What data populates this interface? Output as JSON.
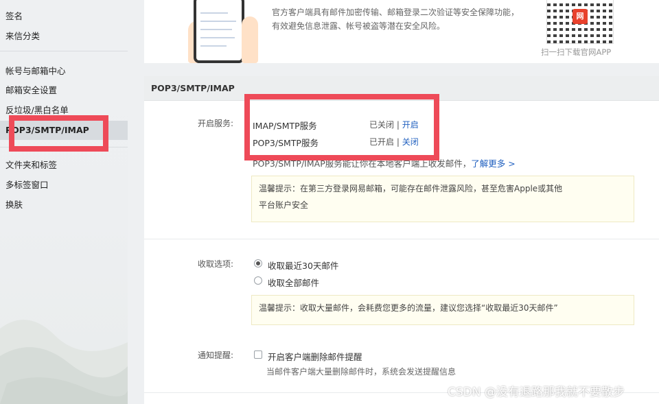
{
  "sidebar": {
    "items": [
      {
        "label": "签名"
      },
      {
        "label": "来信分类"
      },
      {
        "label": "帐号与邮箱中心"
      },
      {
        "label": "邮箱安全设置"
      },
      {
        "label": "反垃圾/黑白名单"
      },
      {
        "label": "POP3/SMTP/IMAP",
        "active": true
      },
      {
        "label": "文件夹和标签"
      },
      {
        "label": "多标签窗口"
      },
      {
        "label": "换肤"
      }
    ]
  },
  "banner": {
    "text": "官方客户端具有邮件加密传输、邮箱登录二次验证等安全保障功能，有效避免信息泄露、帐号被盗等潜在安全风险。",
    "qr_caption": "扫一扫下载官网APP",
    "qr_logo": "网"
  },
  "section": {
    "title": "POP3/SMTP/IMAP",
    "service_label": "开启服务:",
    "services": [
      {
        "name": "IMAP/SMTP服务",
        "status": "已关闭",
        "sep": " | ",
        "action": "开启"
      },
      {
        "name": "POP3/SMTP服务",
        "status": "已开启",
        "sep": " | ",
        "action": "关闭"
      }
    ],
    "desc": "POP3/SMTP/IMAP服务能让你在本地客户端上收发邮件，",
    "learn_more": "了解更多 >",
    "tip1_line1": "温馨提示：在第三方登录网易邮箱，可能存在邮件泄露风险，甚至危害Apple或其他",
    "tip1_line2": "平台账户安全",
    "receive_label": "收取选项:",
    "receive_options": [
      {
        "label": "收取最近30天邮件",
        "checked": true
      },
      {
        "label": "收取全部邮件",
        "checked": false
      }
    ],
    "tip2": "温馨提示：收取大量邮件，会耗费您更多的流量，建议您选择“收取最近30天邮件”",
    "notify_label": "通知提醒:",
    "notify_checkbox": "开启客户端删除邮件提醒",
    "notify_note": "当邮件客户端大量删除邮件时，系统会发送提醒信息"
  },
  "watermark": "CSDN @没有退路那我就不要散步",
  "colors": {
    "highlight": "#ee4a58",
    "link": "#1f5fbf"
  }
}
